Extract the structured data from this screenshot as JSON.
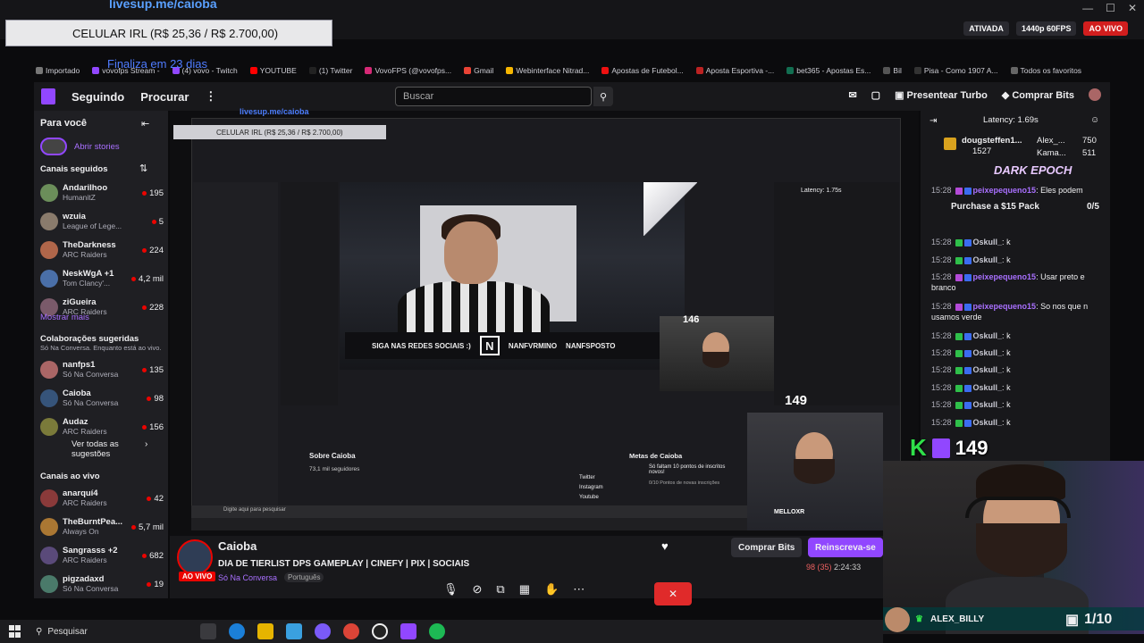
{
  "overlay": {
    "url": "livesup.me/caioba",
    "goal": "CELULAR IRL (R$ 25,36 / R$ 2.700,00)",
    "goal_sub": "Finaliza em 23 dias"
  },
  "status": {
    "ativada": "ATIVADA",
    "quality": "1440p 60FPS",
    "live": "AO VIVO"
  },
  "bookmarks": [
    {
      "label": "Importado",
      "color": "#777"
    },
    {
      "label": "vovofps Stream -",
      "color": "#9147ff"
    },
    {
      "label": "(4) vovo - Twitch",
      "color": "#9147ff"
    },
    {
      "label": "YOUTUBE",
      "color": "#ff0000"
    },
    {
      "label": "(1) Twitter",
      "color": "#222"
    },
    {
      "label": "VovoFPS (@vovofps...",
      "color": "#d62976"
    },
    {
      "label": "Gmail",
      "color": "#ea4335"
    },
    {
      "label": "Webinterface Nitrad...",
      "color": "#f6b600"
    },
    {
      "label": "Apostas de Futebol...",
      "color": "#e11"
    },
    {
      "label": "Aposta Esportiva -...",
      "color": "#b22"
    },
    {
      "label": "bet365 - Apostas Es...",
      "color": "#126e51"
    },
    {
      "label": "Bil",
      "color": "#555"
    },
    {
      "label": "Pisa - Como 1907 A...",
      "color": "#333"
    },
    {
      "label": "Todos os favoritos",
      "color": "#666"
    }
  ],
  "nav": {
    "seguindo": "Seguindo",
    "procurar": "Procurar",
    "search_placeholder": "Buscar",
    "turbo": "Presentear Turbo",
    "bits": "Comprar Bits"
  },
  "sidebar": {
    "para_voce": "Para você",
    "abrir_stories": "Abrir stories",
    "canais_seguidos": "Canais seguidos",
    "followed": [
      {
        "name": "Andarilhoo",
        "game": "HumanitZ",
        "viewers": "195",
        "color": "#6b8e5a"
      },
      {
        "name": "wzuia",
        "game": "League of Lege...",
        "viewers": "5",
        "color": "#8a7b6c"
      },
      {
        "name": "TheDarkness",
        "game": "ARC Raiders",
        "viewers": "224",
        "color": "#b0664a"
      },
      {
        "name": "NeskWgA +1",
        "game": "Tom Clancy'...",
        "viewers": "4,2 mil",
        "color": "#4a6fa8"
      },
      {
        "name": "ziGueira",
        "game": "ARC Raiders",
        "viewers": "228",
        "color": "#7a5a6a"
      }
    ],
    "mostrar_mais": "Mostrar mais",
    "colab_title": "Colaborações sugeridas",
    "colab_sub": "Só Na Conversa. Enquanto está ao vivo.",
    "colabs": [
      {
        "name": "nanfps1",
        "game": "Só Na Conversa",
        "viewers": "135",
        "color": "#a66"
      },
      {
        "name": "Caioba",
        "game": "Só Na Conversa",
        "viewers": "98",
        "color": "#36547a"
      },
      {
        "name": "Audaz",
        "game": "ARC Raiders",
        "viewers": "156",
        "color": "#7a7a3a"
      }
    ],
    "ver_todas": "Ver todas as sugestões",
    "canais_ao_vivo": "Canais ao vivo",
    "live": [
      {
        "name": "anarquí4",
        "game": "ARC Raiders",
        "viewers": "42",
        "color": "#8a3a3a"
      },
      {
        "name": "TheBurntPea...",
        "game": "Always On",
        "viewers": "5,7 mil",
        "color": "#aa7733"
      },
      {
        "name": "Sangrasss +2",
        "game": "ARC Raiders",
        "viewers": "682",
        "color": "#5a4a7a"
      },
      {
        "name": "pigzadaxd",
        "game": "Só Na Conversa",
        "viewers": "19",
        "color": "#4a7a6a"
      }
    ]
  },
  "nested": {
    "url": "livesup.me/caioba",
    "goal": "CELULAR IRL (R$ 25,36 / R$ 2.700,00)",
    "social": "SIGA NAS REDES SOCIAIS :)",
    "handle1": "NANFVRMINO",
    "handle2": "NANFSPOSTO",
    "latency": "Latency: 1.75s",
    "sobre": "Sobre Caioba",
    "seguidores": "73,1 mil seguidores",
    "metas": "Metas de Caioba",
    "meta_text": "Só faltam 10 pontos de inscritos novos!",
    "meta_count": "0/10 Pontos de novas inscrições",
    "twitter": "Twitter",
    "instagram": "Instagram",
    "youtube": "Youtube",
    "chat_user": "Oskull_",
    "search_taskbar": "Digite aqui para pesquisar"
  },
  "stream": {
    "channel": "Caioba",
    "title": "DIA DE TIERLIST DPS GAMEPLAY | CINEFY | PIX | SOCIAIS",
    "category": "Só Na Conversa",
    "language": "Português",
    "ao_vivo": "AO VIVO",
    "bits": "Comprar Bits",
    "sub": "Reinscreva-se",
    "viewers": "98 (35)",
    "uptime": "2:24:33"
  },
  "chat": {
    "latency": "Latency: 1.69s",
    "gifter": "dougsteffen1...",
    "gifter_count": "1527",
    "gift2_name": "Alex_...",
    "gift2_count": "750",
    "gift3_name": "Kama...",
    "gift3_count": "511",
    "game_title": "DARK EPOCH",
    "pack": "Purchase a $15 Pack",
    "pack_count": "0/5",
    "lines": [
      {
        "ts": "15:28",
        "user": "peixepequeno15",
        "type": "peixe",
        "text": "Eles podem"
      },
      {
        "ts": "15:28",
        "user": "Oskull_",
        "type": "oskull",
        "text": "k"
      },
      {
        "ts": "15:28",
        "user": "Oskull_",
        "type": "oskull",
        "text": "k"
      },
      {
        "ts": "15:28",
        "user": "peixepequeno15",
        "type": "peixe",
        "text": "Usar preto e branco"
      },
      {
        "ts": "15:28",
        "user": "peixepequeno15",
        "type": "peixe",
        "text": "So nos que n usamos verde"
      },
      {
        "ts": "15:28",
        "user": "Oskull_",
        "type": "oskull",
        "text": "k"
      },
      {
        "ts": "15:28",
        "user": "Oskull_",
        "type": "oskull",
        "text": "k"
      },
      {
        "ts": "15:28",
        "user": "Oskull_",
        "type": "oskull",
        "text": "k"
      },
      {
        "ts": "15:28",
        "user": "Oskull_",
        "type": "oskull",
        "text": "k"
      },
      {
        "ts": "15:28",
        "user": "Oskull_",
        "type": "oskull",
        "text": "k"
      },
      {
        "ts": "15:28",
        "user": "Oskull_",
        "type": "oskull",
        "text": "k"
      }
    ]
  },
  "cam": {
    "viewers_big": "149",
    "viewers_mid": "149",
    "viewers_small": "146",
    "alex": "ALEX_BILLY",
    "counter": "1/10",
    "mellox": "MELLOXR"
  },
  "taskbar": {
    "search": "Pesquisar"
  }
}
